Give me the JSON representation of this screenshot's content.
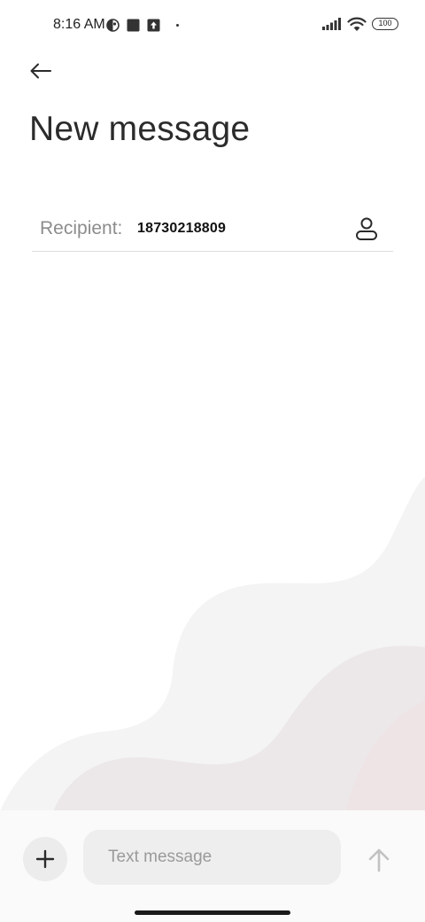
{
  "status_bar": {
    "time": "8:16 AM",
    "battery": "100",
    "icons_left": [
      "data-saver-icon",
      "square-notification-icon",
      "upload-notification-icon",
      "dot-icon"
    ],
    "icons_right": [
      "signal-icon",
      "wifi-icon",
      "battery-icon"
    ]
  },
  "header": {
    "back_icon": "arrow-left-icon",
    "title": "New message"
  },
  "recipient": {
    "label": "Recipient:",
    "value": "18730218809",
    "contact_icon": "person-icon"
  },
  "composer": {
    "add_icon": "plus-icon",
    "placeholder": "Text message",
    "send_icon": "arrow-up-icon"
  },
  "colors": {
    "background": "#ffffff",
    "wave_light": "#f4f4f4",
    "wave_mid": "#ece8e9",
    "wave_pink": "#efe6e7",
    "input_bg": "#eeeeee"
  }
}
